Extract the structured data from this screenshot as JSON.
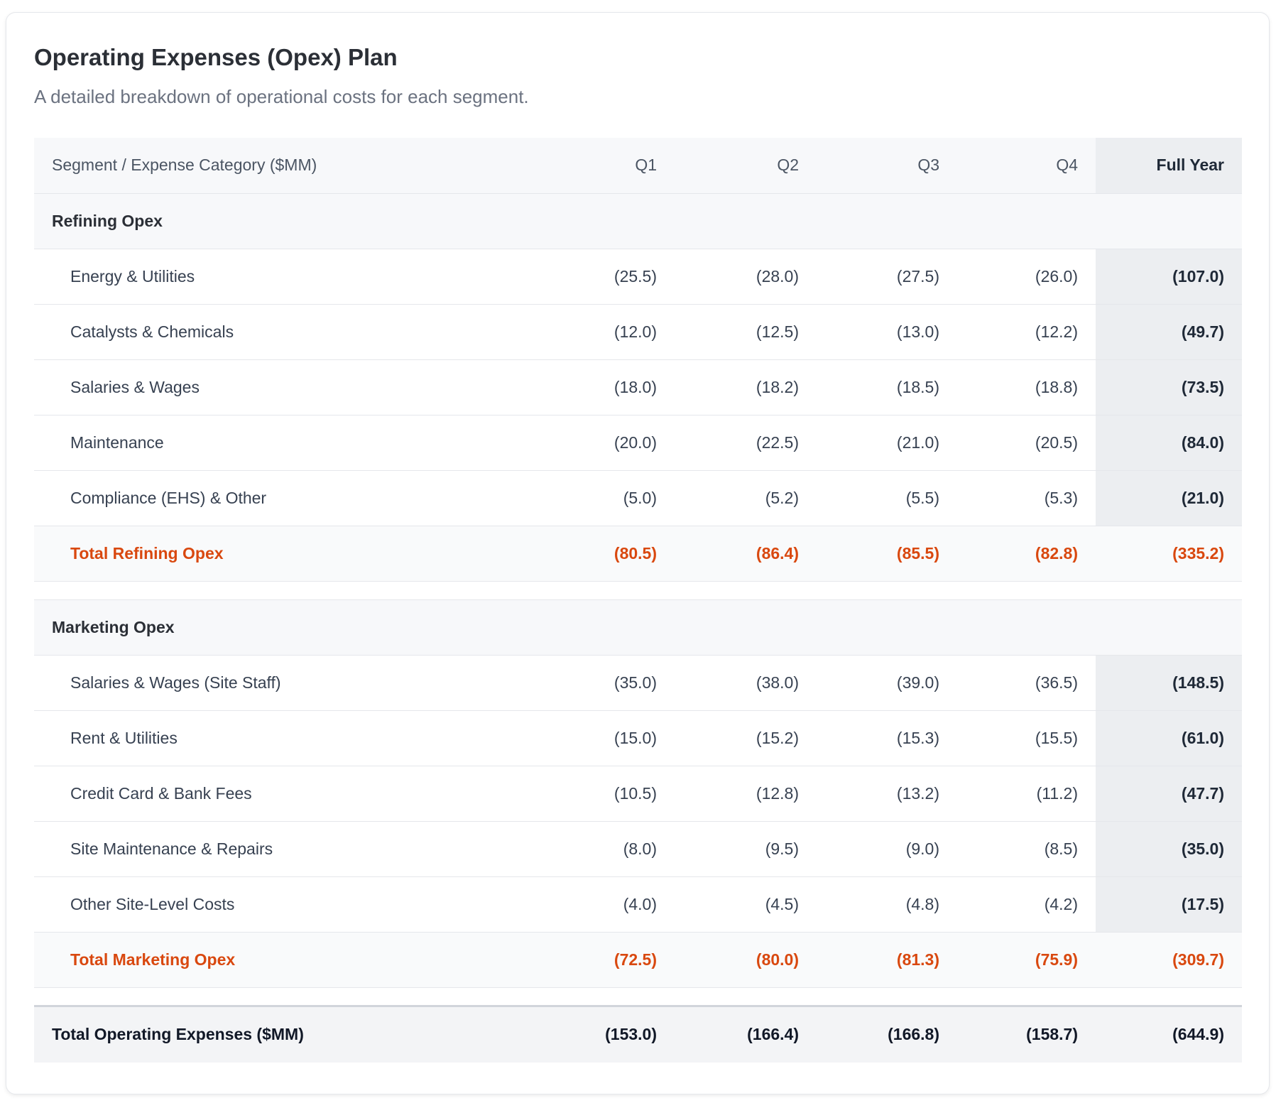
{
  "title": "Operating Expenses (Opex) Plan",
  "subtitle": "A detailed breakdown of operational costs for each segment.",
  "columns": [
    "Segment / Expense Category ($MM)",
    "Q1",
    "Q2",
    "Q3",
    "Q4",
    "Full Year"
  ],
  "accent_color": "#d9480f",
  "refining": {
    "label": "Refining Opex",
    "rows": [
      {
        "label": "Energy & Utilities",
        "q1": "(25.5)",
        "q2": "(28.0)",
        "q3": "(27.5)",
        "q4": "(26.0)",
        "fy": "(107.0)"
      },
      {
        "label": "Catalysts & Chemicals",
        "q1": "(12.0)",
        "q2": "(12.5)",
        "q3": "(13.0)",
        "q4": "(12.2)",
        "fy": "(49.7)"
      },
      {
        "label": "Salaries & Wages",
        "q1": "(18.0)",
        "q2": "(18.2)",
        "q3": "(18.5)",
        "q4": "(18.8)",
        "fy": "(73.5)"
      },
      {
        "label": "Maintenance",
        "q1": "(20.0)",
        "q2": "(22.5)",
        "q3": "(21.0)",
        "q4": "(20.5)",
        "fy": "(84.0)"
      },
      {
        "label": "Compliance (EHS) & Other",
        "q1": "(5.0)",
        "q2": "(5.2)",
        "q3": "(5.5)",
        "q4": "(5.3)",
        "fy": "(21.0)"
      }
    ],
    "total": {
      "label": "Total Refining Opex",
      "q1": "(80.5)",
      "q2": "(86.4)",
      "q3": "(85.5)",
      "q4": "(82.8)",
      "fy": "(335.2)"
    }
  },
  "marketing": {
    "label": "Marketing Opex",
    "rows": [
      {
        "label": "Salaries & Wages (Site Staff)",
        "q1": "(35.0)",
        "q2": "(38.0)",
        "q3": "(39.0)",
        "q4": "(36.5)",
        "fy": "(148.5)"
      },
      {
        "label": "Rent & Utilities",
        "q1": "(15.0)",
        "q2": "(15.2)",
        "q3": "(15.3)",
        "q4": "(15.5)",
        "fy": "(61.0)"
      },
      {
        "label": "Credit Card & Bank Fees",
        "q1": "(10.5)",
        "q2": "(12.8)",
        "q3": "(13.2)",
        "q4": "(11.2)",
        "fy": "(47.7)"
      },
      {
        "label": "Site Maintenance & Repairs",
        "q1": "(8.0)",
        "q2": "(9.5)",
        "q3": "(9.0)",
        "q4": "(8.5)",
        "fy": "(35.0)"
      },
      {
        "label": "Other Site-Level Costs",
        "q1": "(4.0)",
        "q2": "(4.5)",
        "q3": "(4.8)",
        "q4": "(4.2)",
        "fy": "(17.5)"
      }
    ],
    "total": {
      "label": "Total Marketing Opex",
      "q1": "(72.5)",
      "q2": "(80.0)",
      "q3": "(81.3)",
      "q4": "(75.9)",
      "fy": "(309.7)"
    }
  },
  "grand_total": {
    "label": "Total Operating Expenses ($MM)",
    "q1": "(153.0)",
    "q2": "(166.4)",
    "q3": "(166.8)",
    "q4": "(158.7)",
    "fy": "(644.9)"
  }
}
